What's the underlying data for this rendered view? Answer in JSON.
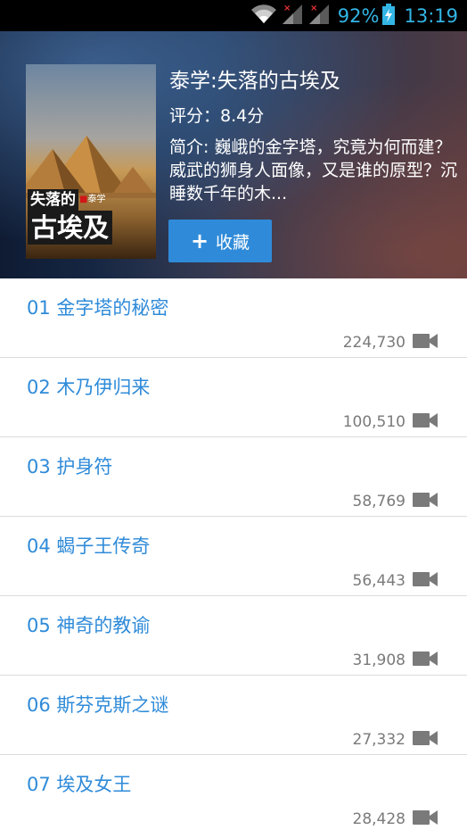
{
  "status_bar": {
    "battery_pct": "92%",
    "time": "13:19",
    "icons": [
      "wifi-icon",
      "signal-no-sim-icon",
      "signal-no-sim-icon",
      "battery-charging-icon"
    ],
    "accent_color": "#33b5e5"
  },
  "header": {
    "cover": {
      "title_line1": "失落的",
      "title_line2": "古埃及",
      "brand": "泰学"
    },
    "title": "泰学:失落的古埃及",
    "rating": "评分：8.4分",
    "description": "简介: 巍峨的金字塔，究竟为何而建？威武的狮身人面像，又是谁的原型？沉睡数千年的木...",
    "favorite_button": {
      "icon": "plus-icon",
      "label": "收藏",
      "color": "#2f8bd9"
    }
  },
  "episodes": [
    {
      "title": "01 金字塔的秘密",
      "views": "224,730",
      "icon": "video-camera-icon"
    },
    {
      "title": "02 木乃伊归来",
      "views": "100,510",
      "icon": "video-camera-icon"
    },
    {
      "title": "03 护身符",
      "views": "58,769",
      "icon": "video-camera-icon"
    },
    {
      "title": "04 蝎子王传奇",
      "views": "56,443",
      "icon": "video-camera-icon"
    },
    {
      "title": "05 神奇的教谕",
      "views": "31,908",
      "icon": "video-camera-icon"
    },
    {
      "title": "06 斯芬克斯之谜",
      "views": "27,332",
      "icon": "video-camera-icon"
    },
    {
      "title": "07 埃及女王",
      "views": "28,428",
      "icon": "video-camera-icon"
    }
  ],
  "colors": {
    "episode_title": "#2f8bd9",
    "view_count": "#7a7a7a",
    "divider": "#dcdcdc"
  }
}
